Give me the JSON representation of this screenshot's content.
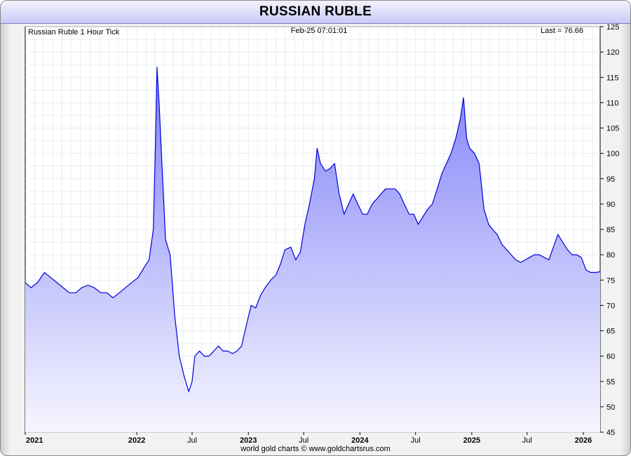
{
  "title": "RUSSIAN RUBLE",
  "header": {
    "left": "Russian Ruble 1 Hour Tick",
    "center": "Feb-25  07:01:01",
    "right": "Last = 76.66"
  },
  "footer": "world gold charts © www.goldchartsrus.com",
  "colors": {
    "line": "#0000dd",
    "fill_top": "#8080f8",
    "fill_bottom": "#f6f6ff",
    "grid": "#dde8f0"
  },
  "chart_data": {
    "type": "area",
    "ylim": [
      45,
      125
    ],
    "y_ticks": [
      45,
      50,
      55,
      60,
      65,
      70,
      75,
      80,
      85,
      90,
      95,
      100,
      105,
      110,
      115,
      120,
      125
    ],
    "xlim": [
      "2021-01-01",
      "2026-02-25"
    ],
    "x_ticks": [
      {
        "date": "2021-01-01",
        "label": "2021",
        "bold": true
      },
      {
        "date": "2022-01-01",
        "label": "2022",
        "bold": true
      },
      {
        "date": "2022-07-01",
        "label": "Jul",
        "bold": false
      },
      {
        "date": "2023-01-01",
        "label": "2023",
        "bold": true
      },
      {
        "date": "2023-07-01",
        "label": "Jul",
        "bold": false
      },
      {
        "date": "2024-01-01",
        "label": "2024",
        "bold": true
      },
      {
        "date": "2024-07-01",
        "label": "Jul",
        "bold": false
      },
      {
        "date": "2025-01-01",
        "label": "2025",
        "bold": true
      },
      {
        "date": "2025-07-01",
        "label": "Jul",
        "bold": false
      },
      {
        "date": "2026-01-01",
        "label": "2026",
        "bold": true
      }
    ],
    "series": [
      {
        "x": [
          "2021-01-01",
          "2021-01-20",
          "2021-02-10",
          "2021-03-05",
          "2021-03-25",
          "2021-04-15",
          "2021-05-05",
          "2021-05-25",
          "2021-06-15",
          "2021-07-05",
          "2021-07-25",
          "2021-08-15",
          "2021-09-05",
          "2021-09-25",
          "2021-10-15",
          "2021-11-05",
          "2021-11-25",
          "2021-12-15",
          "2022-01-05",
          "2022-01-25",
          "2022-02-10",
          "2022-02-24",
          "2022-03-03",
          "2022-03-08",
          "2022-03-15",
          "2022-03-25",
          "2022-04-05",
          "2022-04-20",
          "2022-05-05",
          "2022-05-20",
          "2022-06-05",
          "2022-06-20",
          "2022-07-01",
          "2022-07-10",
          "2022-07-25",
          "2022-08-10",
          "2022-08-25",
          "2022-09-10",
          "2022-09-25",
          "2022-10-10",
          "2022-10-25",
          "2022-11-10",
          "2022-11-25",
          "2022-12-10",
          "2022-12-25",
          "2023-01-10",
          "2023-01-25",
          "2023-02-10",
          "2023-02-25",
          "2023-03-15",
          "2023-04-01",
          "2023-04-15",
          "2023-05-01",
          "2023-05-20",
          "2023-06-05",
          "2023-06-20",
          "2023-07-05",
          "2023-07-20",
          "2023-08-05",
          "2023-08-14",
          "2023-08-25",
          "2023-09-10",
          "2023-09-25",
          "2023-10-10",
          "2023-10-25",
          "2023-11-10",
          "2023-11-25",
          "2023-12-10",
          "2023-12-25",
          "2024-01-10",
          "2024-01-25",
          "2024-02-10",
          "2024-02-25",
          "2024-03-10",
          "2024-03-25",
          "2024-04-10",
          "2024-04-25",
          "2024-05-10",
          "2024-05-25",
          "2024-06-10",
          "2024-06-25",
          "2024-07-10",
          "2024-07-25",
          "2024-08-10",
          "2024-08-25",
          "2024-09-10",
          "2024-09-25",
          "2024-10-10",
          "2024-10-25",
          "2024-11-10",
          "2024-11-25",
          "2024-12-05",
          "2024-12-15",
          "2024-12-25",
          "2025-01-10",
          "2025-01-25",
          "2025-02-10",
          "2025-02-25",
          "2025-03-10",
          "2025-03-25",
          "2025-04-10",
          "2025-04-25",
          "2025-05-10",
          "2025-05-25",
          "2025-06-10",
          "2025-06-25",
          "2025-07-10",
          "2025-07-25",
          "2025-08-10",
          "2025-08-25",
          "2025-09-10",
          "2025-09-25",
          "2025-10-10",
          "2025-10-25",
          "2025-11-10",
          "2025-11-25",
          "2025-12-10",
          "2025-12-25",
          "2026-01-10",
          "2026-01-25",
          "2026-02-10",
          "2026-02-25"
        ],
        "y": [
          74.5,
          73.5,
          74.5,
          76.5,
          75.5,
          74.5,
          73.5,
          72.5,
          72.5,
          73.5,
          74,
          73.5,
          72.5,
          72.5,
          71.5,
          72.5,
          73.5,
          74.5,
          75.5,
          77.5,
          79,
          85,
          102,
          117,
          110,
          97,
          83,
          80,
          68,
          60,
          56,
          53,
          55,
          60,
          61,
          60,
          60,
          61,
          62,
          61,
          61,
          60.5,
          61,
          62,
          66,
          70,
          69.5,
          72,
          73.5,
          75,
          76,
          78,
          81,
          81.5,
          79,
          80.5,
          86,
          90,
          95,
          101,
          98,
          96.5,
          97,
          98,
          92,
          88,
          90,
          92,
          90,
          88,
          88,
          90,
          91,
          92,
          93,
          93,
          93,
          92,
          90,
          88,
          88,
          86,
          87.5,
          89,
          90,
          93,
          96,
          98,
          100,
          103,
          107,
          111,
          103,
          101,
          100,
          98,
          89,
          86,
          85,
          84,
          82,
          81,
          80,
          79,
          78.5,
          79,
          79.5,
          80,
          80,
          79.5,
          79,
          81.5,
          84,
          82.5,
          81,
          80,
          80,
          79.5,
          77,
          76.5,
          76.5,
          76.66
        ]
      }
    ]
  }
}
